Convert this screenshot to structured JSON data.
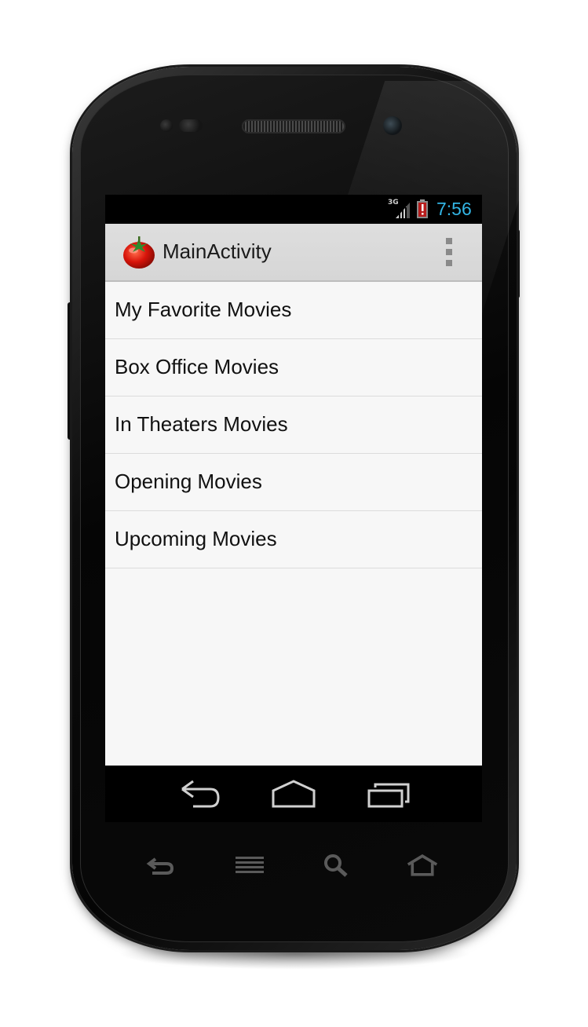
{
  "status_bar": {
    "network_type": "3G",
    "time": "7:56",
    "icons": [
      "signal-icon",
      "battery-alert-icon"
    ],
    "time_color": "#33b5e5"
  },
  "action_bar": {
    "title": "MainActivity",
    "app_icon": "tomato-icon",
    "overflow_icon": "overflow-menu-icon"
  },
  "menu": {
    "items": [
      {
        "label": "My Favorite Movies"
      },
      {
        "label": "Box Office Movies"
      },
      {
        "label": "In Theaters Movies"
      },
      {
        "label": "Opening Movies"
      },
      {
        "label": "Upcoming Movies"
      }
    ]
  },
  "nav_bar": {
    "buttons": [
      "back-icon",
      "home-icon",
      "recent-apps-icon"
    ]
  },
  "hardware_buttons": [
    "back-icon",
    "menu-icon",
    "search-icon",
    "home-icon"
  ],
  "colors": {
    "action_bar_bg": "#d6d6d6",
    "content_bg": "#f7f7f7",
    "accent": "#33b5e5"
  }
}
